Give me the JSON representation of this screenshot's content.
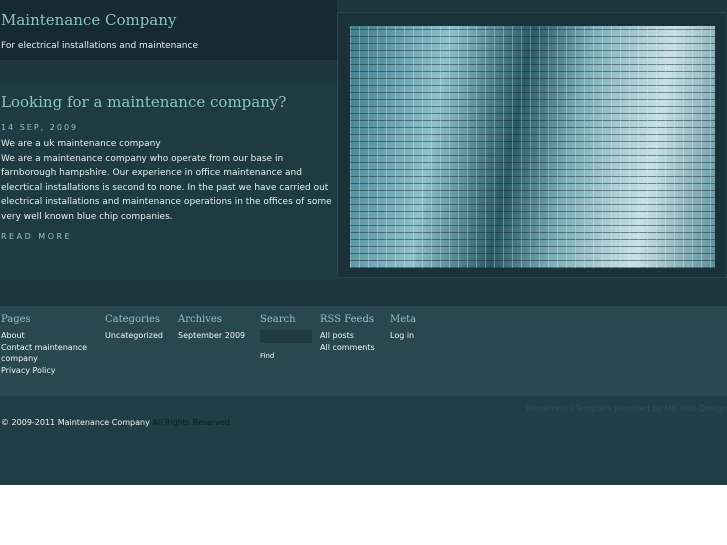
{
  "header": {
    "title": "Maintenance Company",
    "tagline": "For electrical installations and maintenance"
  },
  "post": {
    "title": "Looking for a maintenance company?",
    "date": "14 SEP, 2009",
    "subtitle": "We are a uk maintenance company",
    "body": "We are a maintenance company who operate from our base in farnborough hampshire. Our experience in office maintenance and elecrtical installations is second to none. In the past we have carried out electrical installations and maintenance operations in the offices of some very well known blue chip companies.",
    "read_more": "READ MORE"
  },
  "widgets": {
    "pages": {
      "title": "Pages",
      "items": [
        "About",
        "Contact maintenance company",
        "Privacy Policy"
      ]
    },
    "categories": {
      "title": "Categories",
      "items": [
        "Uncategorized"
      ]
    },
    "archives": {
      "title": "Archives",
      "items": [
        "September 2009"
      ]
    },
    "search": {
      "title": "Search",
      "value": "",
      "button": "Find"
    },
    "rss": {
      "title": "RSS Feeds",
      "items": [
        "All posts",
        "All comments"
      ]
    },
    "meta": {
      "title": "Meta",
      "items": [
        "Log in"
      ]
    }
  },
  "footer": {
    "credits": "WordPress | Template provided by MB Web Design",
    "copyright_prefix": "© 2009-2011",
    "company": "Maintenance Company",
    "rights": "All Rights Reserved"
  }
}
